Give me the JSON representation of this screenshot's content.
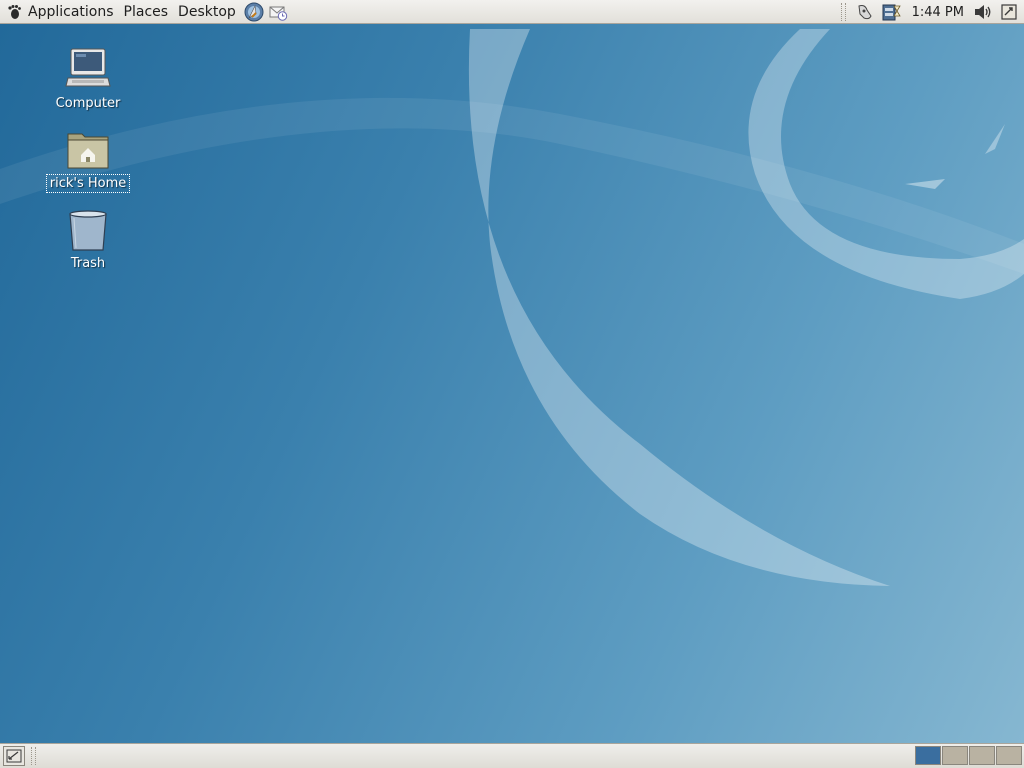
{
  "top_panel": {
    "menus": [
      {
        "label": "Applications"
      },
      {
        "label": "Places"
      },
      {
        "label": "Desktop"
      }
    ],
    "launchers": [
      "web-browser-icon",
      "email-client-icon"
    ],
    "tray_icons": [
      "network-monitor-icon",
      "update-notifier-icon"
    ],
    "clock": "1:44 PM",
    "volume_icon": "volume-icon",
    "logout_icon": "shutdown-icon"
  },
  "desktop": {
    "icons": [
      {
        "label": "Computer",
        "icon": "computer-icon"
      },
      {
        "label": "rick's Home",
        "icon": "home-folder-icon",
        "selected": true
      },
      {
        "label": "Trash",
        "icon": "trash-icon"
      }
    ]
  },
  "bottom_panel": {
    "show_desktop_icon": "show-desktop-icon",
    "workspaces": [
      {
        "index": 1,
        "active": true
      },
      {
        "index": 2,
        "active": false
      },
      {
        "index": 3,
        "active": false
      },
      {
        "index": 4,
        "active": false
      }
    ]
  },
  "colors": {
    "panel": "#e6e4de",
    "desktop_dark": "#22699a",
    "desktop_light": "#86b7d1",
    "workspace_active": "#3a6e9f",
    "workspace_inactive": "#b9b2a2"
  }
}
